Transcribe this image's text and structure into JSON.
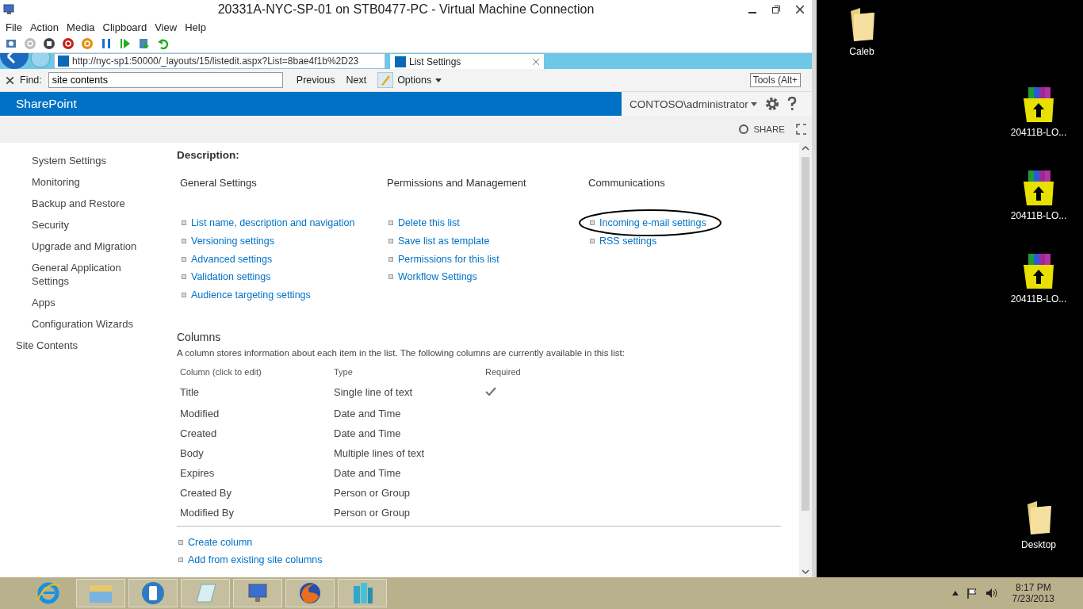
{
  "window": {
    "title": "20331A-NYC-SP-01 on STB0477-PC - Virtual Machine Connection",
    "menu": [
      "File",
      "Action",
      "Media",
      "Clipboard",
      "View",
      "Help"
    ]
  },
  "browser": {
    "address": "http://nyc-sp1:50000/_layouts/15/listedit.aspx?List=8bae4f1b%2D23",
    "tab": "List Settings",
    "find_label": "Find:",
    "find_value": "site contents",
    "previous": "Previous",
    "next": "Next",
    "options": "Options",
    "tooltip": "Tools (Alt+"
  },
  "sharepoint": {
    "brand": "SharePoint",
    "user": "CONTOSO\\administrator",
    "share": "SHARE"
  },
  "nav_sub_items": [
    "System Settings",
    "Monitoring",
    "Backup and Restore",
    "Security",
    "Upgrade and Migration",
    "General Application Settings",
    "Apps",
    "Configuration Wizards"
  ],
  "nav_items": [
    "Site Contents"
  ],
  "description_label": "Description:",
  "settings_groups": [
    {
      "title": "General Settings",
      "links": [
        {
          "label": "List name, description and navigation",
          "circled": false
        },
        {
          "label": "Versioning settings",
          "circled": false
        },
        {
          "label": "Advanced settings",
          "circled": false
        },
        {
          "label": "Validation settings",
          "circled": false
        },
        {
          "label": "Audience targeting settings",
          "circled": false
        }
      ]
    },
    {
      "title": "Permissions and Management",
      "links": [
        {
          "label": "Delete this list",
          "circled": false
        },
        {
          "label": "Save list as template",
          "circled": false
        },
        {
          "label": "Permissions for this list",
          "circled": false
        },
        {
          "label": "Workflow Settings",
          "circled": false
        }
      ]
    },
    {
      "title": "Communications",
      "links": [
        {
          "label": "Incoming e-mail settings",
          "circled": true
        },
        {
          "label": "RSS settings",
          "circled": false
        }
      ]
    }
  ],
  "columns": {
    "title": "Columns",
    "description": "A column stores information about each item in the list. The following columns are currently available in this list:",
    "headers": [
      "Column (click to edit)",
      "Type",
      "Required"
    ],
    "rows": [
      {
        "name": "Title",
        "type": "Single line of text",
        "required": true
      },
      {
        "name": "Modified",
        "type": "Date and Time",
        "required": false
      },
      {
        "name": "Created",
        "type": "Date and Time",
        "required": false
      },
      {
        "name": "Body",
        "type": "Multiple lines of text",
        "required": false
      },
      {
        "name": "Expires",
        "type": "Date and Time",
        "required": false
      },
      {
        "name": "Created By",
        "type": "Person or Group",
        "required": false
      },
      {
        "name": "Modified By",
        "type": "Person or Group",
        "required": false
      }
    ],
    "links": [
      "Create column",
      "Add from existing site columns"
    ]
  },
  "desktop_icons": [
    {
      "label": "Caleb",
      "kind": "folder"
    },
    {
      "label": "20411B-LO...",
      "kind": "archive"
    },
    {
      "label": "20411B-LO...",
      "kind": "archive"
    },
    {
      "label": "20411B-LO...",
      "kind": "archive"
    },
    {
      "label": "Desktop",
      "kind": "folder"
    }
  ],
  "taskbar": {
    "apps": [
      {
        "kind": "browser",
        "running": false
      },
      {
        "kind": "files",
        "running": true
      },
      {
        "kind": "phone",
        "running": true
      },
      {
        "kind": "notepad",
        "running": true
      },
      {
        "kind": "computer",
        "running": true
      },
      {
        "kind": "firefox",
        "running": true
      },
      {
        "kind": "servers",
        "running": true
      }
    ],
    "time": "8:17 PM",
    "date": "7/23/2013"
  }
}
